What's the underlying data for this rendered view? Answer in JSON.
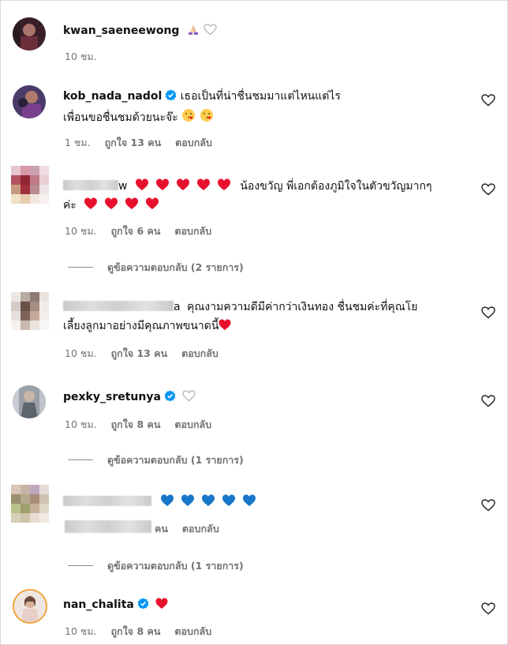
{
  "comments": [
    {
      "username": "kwan_saeneewong",
      "time": "10 ชม."
    },
    {
      "username": "kob_nada_nadol",
      "text_line1": "เธอเป็นที่น่าชื่นชมมาแต่ไหนแต่ไร",
      "text_line2": "เพื่อนขอชื่นชมด้วยนะจ๊ะ",
      "time": "1 ชม.",
      "likes": "ถูกใจ 13 คน",
      "reply": "ตอบกลับ"
    },
    {
      "username_visible": "w",
      "text_line1": "น้องขวัญ พี่เอกต้องภูมิใจในตัวขวัญมากๆ",
      "text_line2": "ค่ะ",
      "time": "10 ชม.",
      "likes": "ถูกใจ 6 คน",
      "reply": "ตอบกลับ",
      "view_replies": "ดูข้อความตอบกลับ (2 รายการ)"
    },
    {
      "username_visible": "a",
      "text_line1": "คุณงามความดีมีค่ากว่าเงินทอง ชื่นชมค่ะที่คุณโย",
      "text_line2": "เลี้ยงลูกมาอย่างมีคุณภาพขนาดนี้",
      "time": "10 ชม.",
      "likes": "ถูกใจ 13 คน",
      "reply": "ตอบกลับ"
    },
    {
      "username": "pexky_sretunya",
      "time": "10 ชม.",
      "likes": "ถูกใจ 8 คน",
      "reply": "ตอบกลับ",
      "view_replies": "ดูข้อความตอบกลับ (1 รายการ)"
    },
    {
      "time_likes_visible": "คน",
      "reply": "ตอบกลับ",
      "view_replies": "ดูข้อความตอบกลับ (1 รายการ)"
    },
    {
      "username": "nan_chalita",
      "time": "10 ชม.",
      "likes": "ถูกใจ 8 คน",
      "reply": "ตอบกลับ"
    }
  ],
  "colors": {
    "verified": "#0095f6",
    "red_heart": "#e8112d",
    "blue_heart": "#1877c9",
    "meta_text": "#737373"
  },
  "icons": [
    "like-heart-icon",
    "verified-badge-icon",
    "kiss-emoji-icon",
    "pray-hands-icon"
  ]
}
